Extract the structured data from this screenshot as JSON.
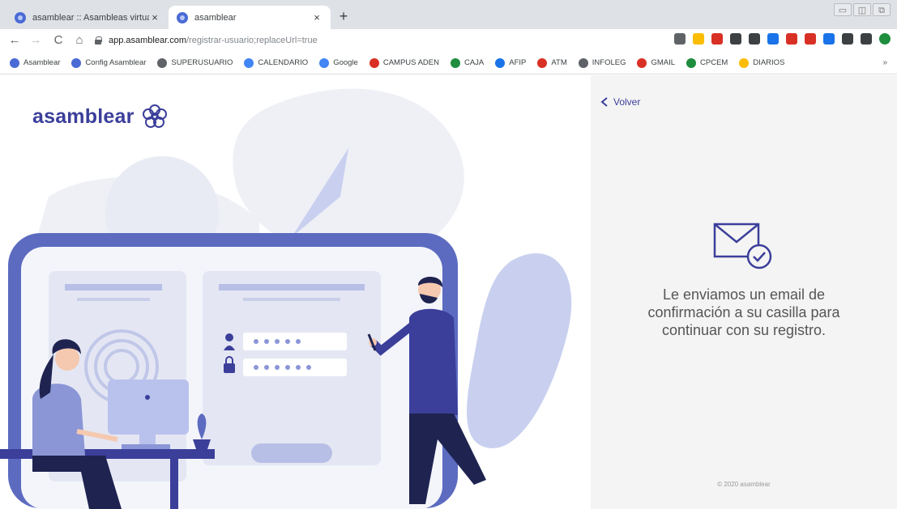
{
  "browser": {
    "tabs": [
      {
        "label": "asamblear :: Asambleas virtuales",
        "close": "×"
      },
      {
        "label": "asamblear",
        "close": "×"
      }
    ],
    "new_tab": "+",
    "window_controls": [
      "▭",
      "◫",
      "⧉"
    ],
    "nav": {
      "back": "←",
      "forward": "→",
      "reload": "C",
      "home": "⌂"
    },
    "url_host": "app.asamblear.com",
    "url_path": "/registrar-usuario;replaceUrl=true",
    "bookmarks": [
      {
        "label": "Asamblear",
        "color": "#4a6bd6"
      },
      {
        "label": "Config Asamblear",
        "color": "#4a6bd6"
      },
      {
        "label": "SUPERUSUARIO",
        "color": "#5f6368"
      },
      {
        "label": "CALENDARIO",
        "color": "#4285f4"
      },
      {
        "label": "Google",
        "color": "#4285f4"
      },
      {
        "label": "CAMPUS ADEN",
        "color": "#d93025"
      },
      {
        "label": "CAJA",
        "color": "#1e8e3e"
      },
      {
        "label": "AFIP",
        "color": "#1a73e8"
      },
      {
        "label": "ATM",
        "color": "#d93025"
      },
      {
        "label": "INFOLEG",
        "color": "#5f6368"
      },
      {
        "label": "GMAIL",
        "color": "#d93025"
      },
      {
        "label": "CPCEM",
        "color": "#1e8e3e"
      },
      {
        "label": "DIARIOS",
        "color": "#fbbc04"
      }
    ],
    "bookmarks_more": "»",
    "extensions": [
      "#5f6368",
      "#fbbc04",
      "#d93025",
      "#3c4043",
      "#3c4043",
      "#1a73e8",
      "#d93025",
      "#d93025",
      "#1a73e8",
      "#3c4043",
      "#3c4043",
      "#1e8e3e"
    ]
  },
  "brand": {
    "name": "asamblear",
    "color": "#3b3f9a",
    "accent": "#5c6bc0"
  },
  "panel": {
    "back_label": "Volver",
    "message": "Le enviamos un email de confirmación a su casilla para continuar con su registro.",
    "copyright": "© 2020 asamblear"
  }
}
